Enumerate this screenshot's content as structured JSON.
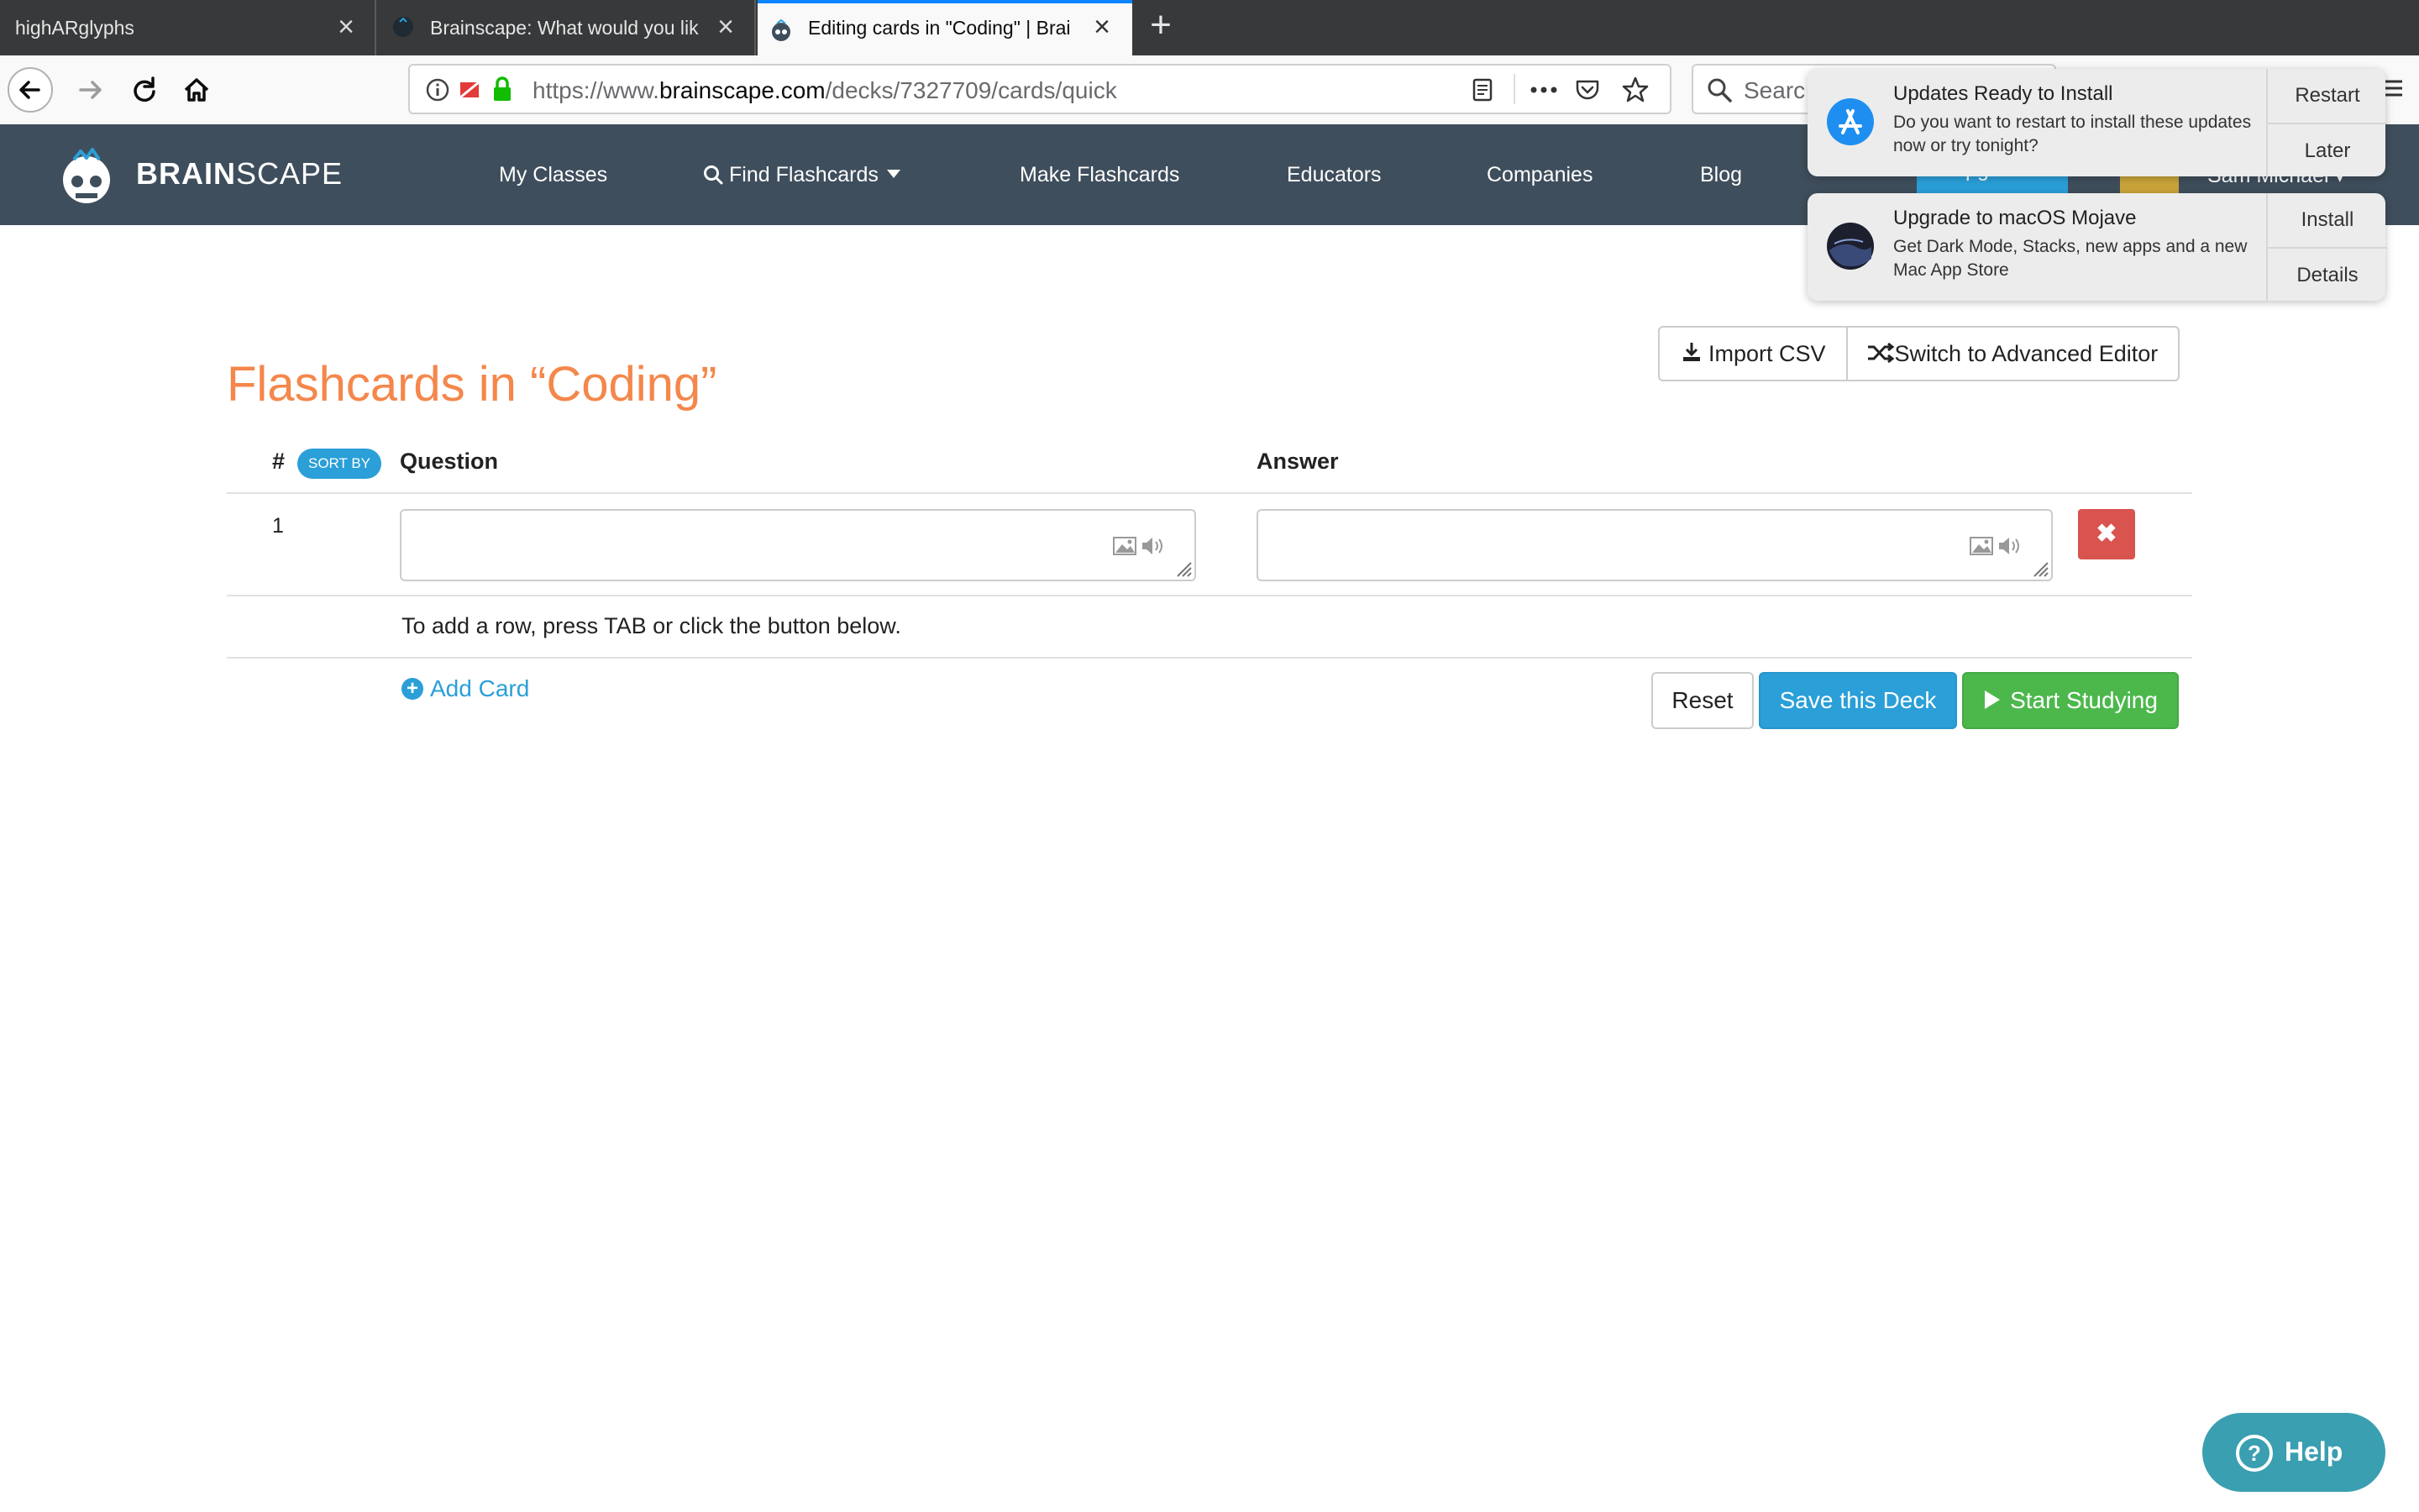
{
  "browser": {
    "tabs": [
      {
        "title": "highARglyphs",
        "active": false
      },
      {
        "title": "Brainscape: What would you lik",
        "active": false
      },
      {
        "title": "Editing cards in \"Coding\" | Brai",
        "active": true
      }
    ],
    "url": {
      "prefix": "https://www.",
      "host": "brainscape.com",
      "path": "/decks/7327709/cards/quick"
    },
    "search_placeholder": "Searc"
  },
  "site_header": {
    "brand_bold": "BRAIN",
    "brand_light": "SCAPE",
    "nav": [
      "My Classes",
      "Find Flashcards",
      "Make Flashcards",
      "Educators",
      "Companies",
      "Blog"
    ],
    "upgrade_label": "Upgrade",
    "user_name": "Sam Michael"
  },
  "main": {
    "title": "Flashcards in “Coding”",
    "import_csv_label": "Import CSV",
    "advanced_editor_label": "Switch to Advanced Editor",
    "columns": {
      "number": "#",
      "sort_by": "SORT BY",
      "question": "Question",
      "answer": "Answer"
    },
    "rows": [
      {
        "number": "1",
        "question": "",
        "answer": ""
      }
    ],
    "hint": "To add a row, press TAB or click the button below.",
    "add_card_label": "Add Card",
    "reset_label": "Reset",
    "save_label": "Save this Deck",
    "study_label": "Start Studying",
    "help_label": "Help"
  },
  "notifications": [
    {
      "title": "Updates Ready to Install",
      "body": "Do you want to restart to install these updates now or try tonight?",
      "actions": [
        "Restart",
        "Later"
      ]
    },
    {
      "title": "Upgrade to macOS Mojave",
      "body": "Get Dark Mode, Stacks, new apps and a new Mac App Store",
      "actions": [
        "Install",
        "Details"
      ]
    }
  ],
  "colors": {
    "header_bg": "#3f4e5c",
    "title_orange": "#f4874b",
    "primary_blue": "#2a9fd8",
    "success_green": "#4cb84c",
    "danger_red": "#d9534f",
    "help_teal": "#3a9fb0"
  }
}
